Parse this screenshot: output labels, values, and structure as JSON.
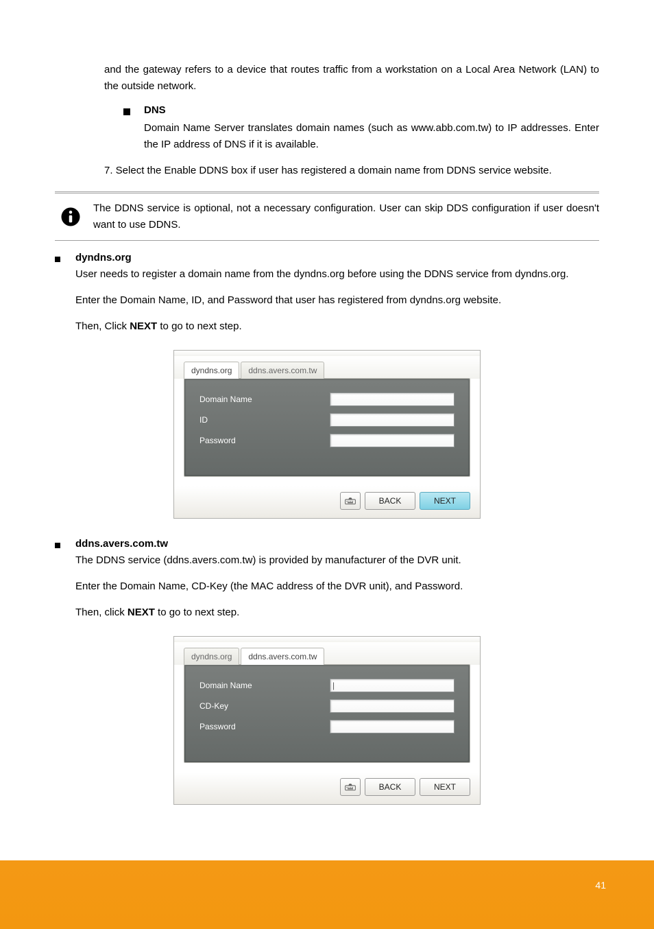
{
  "intro": {
    "p1": "and the gateway refers to a device that routes traffic from a workstation on a Local Area Network (LAN) to the outside network.",
    "dns_bullet_label": "DNS",
    "p2": "Domain Name Server translates domain names (such as www.abb.com.tw) to IP addresses. Enter the IP address of DNS if it is available.",
    "p3": "7. Select the Enable DDNS box if user has registered a domain name from DDNS service website."
  },
  "info_note": "The DDNS service is optional, not a necessary configuration. User can skip DDS configuration if user doesn't want to use DDNS.",
  "dyndns": {
    "bullet_label": "dyndns.org",
    "p1": "User needs to register a domain name from the dyndns.org before using the DDNS service from dyndns.org.",
    "p2": "Enter the Domain Name, ID, and Password that user has registered from dyndns.org website.",
    "p3_part1": "Then, Click ",
    "p3_next": "NEXT",
    "p3_part2": " to go to next step.",
    "tab_a": "dyndns.org",
    "tab_b": "ddns.avers.com.tw",
    "fields": {
      "domain": "Domain Name",
      "id": "ID",
      "pass": "Password"
    },
    "buttons": {
      "back": "BACK",
      "next": "NEXT"
    }
  },
  "avers": {
    "bullet_label": "ddns.avers.com.tw",
    "p1": "The DDNS service (ddns.avers.com.tw) is provided by manufacturer of the DVR unit.",
    "p2": "Enter the Domain Name, CD-Key (the MAC address of the DVR unit), and Password.",
    "p3_part1": "Then, click ",
    "p3_next": "NEXT",
    "p3_part2": " to go to next step.",
    "tab_a": "dyndns.org",
    "tab_b": "ddns.avers.com.tw",
    "fields": {
      "domain": "Domain Name",
      "cdkey": "CD-Key",
      "pass": "Password"
    },
    "buttons": {
      "back": "BACK",
      "next": "NEXT"
    }
  },
  "footer": {
    "page": "41"
  }
}
